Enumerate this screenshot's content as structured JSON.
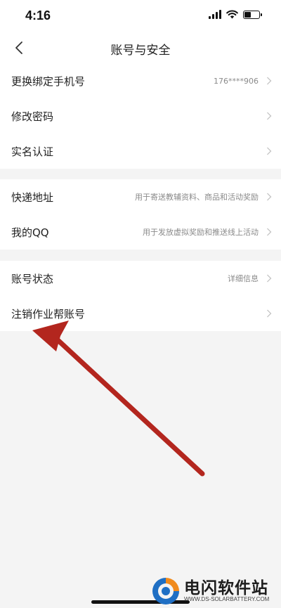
{
  "status_bar": {
    "time": "4:16",
    "battery_level": 0.45
  },
  "nav": {
    "title": "账号与安全",
    "back_icon": "chevron-left-icon"
  },
  "groups": [
    {
      "rows": [
        {
          "label": "更换绑定手机号",
          "value": "176****906"
        },
        {
          "label": "修改密码",
          "value": ""
        },
        {
          "label": "实名认证",
          "value": ""
        }
      ]
    },
    {
      "rows": [
        {
          "label": "快递地址",
          "value": "用于寄送教辅资料、商品和活动奖励"
        },
        {
          "label": "我的QQ",
          "value": "用于发放虚拟奖励和推送线上活动"
        }
      ]
    },
    {
      "rows": [
        {
          "label": "账号状态",
          "value": "详细信息"
        },
        {
          "label": "注销作业帮账号",
          "value": ""
        }
      ]
    }
  ],
  "watermark": {
    "title": "电闪软件站",
    "url": "WWW.DS-SOLARBATTERY.COM"
  },
  "colors": {
    "annotation_arrow": "#b3261e",
    "watermark_blue": "#1f6fc4",
    "watermark_orange": "#f08a1c"
  }
}
